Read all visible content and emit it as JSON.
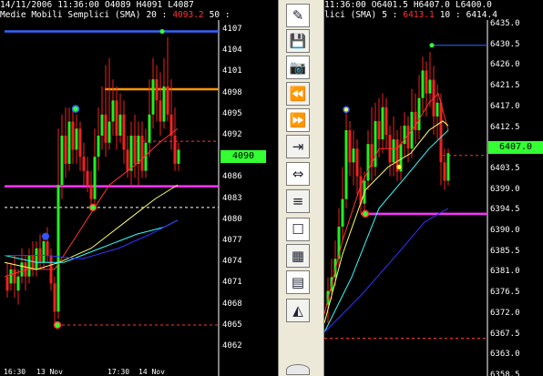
{
  "left_chart": {
    "date": "14/11/2006",
    "time": "11:36:00",
    "open": "O4089",
    "high": "H4091",
    "low": "L4087",
    "indicator": "Medie Mobili Semplici (SMA)",
    "sma1_period": "20 :",
    "sma1_value": "4093.2",
    "sma2_period": "50 :",
    "current_price": "4090",
    "y_ticks": [
      "4107",
      "4104",
      "4101",
      "4098",
      "4095",
      "4092",
      "4089",
      "4086",
      "4083",
      "4080",
      "4077",
      "4074",
      "4071",
      "4068",
      "4065",
      "4062"
    ],
    "x_ticks": [
      "16:30",
      "13 Nov",
      "17:30",
      "14 Nov"
    ],
    "colors": {
      "price_box": "#33ff33",
      "support": "#ff33ff",
      "resistance": "#3366ff",
      "target": "#ff9900"
    }
  },
  "right_chart": {
    "title_fragment": "lici (SMA)",
    "open": "O6401.5",
    "high": "H6407.0",
    "low": "L6400.0",
    "sma1_period": "5 :",
    "sma1_value": "6413.1",
    "sma2_period": "10 :",
    "sma2_value": "6414.4",
    "current_price": "6407.0",
    "y_ticks": [
      "6435.0",
      "6430.5",
      "6426.0",
      "6421.5",
      "6417.0",
      "6412.5",
      "6408.0",
      "6403.5",
      "6399.0",
      "6394.5",
      "6390.0",
      "6385.5",
      "6381.0",
      "6376.5",
      "6372.0",
      "6367.5",
      "6363.0",
      "6358.5"
    ],
    "colors": {
      "price_box": "#33ff33",
      "support": "#ff33ff"
    }
  },
  "toolbar": {
    "buttons": [
      {
        "name": "pencil-tool-button",
        "glyph": "✎"
      },
      {
        "name": "save-button",
        "glyph": "💾"
      },
      {
        "name": "camera-button",
        "glyph": "📷"
      },
      {
        "name": "rewind-button",
        "glyph": "⏪"
      },
      {
        "name": "fast-forward-button",
        "glyph": "⏩"
      },
      {
        "name": "zoom-in-horizontal-button",
        "glyph": "⇥"
      },
      {
        "name": "zoom-out-horizontal-button",
        "glyph": "⇔"
      },
      {
        "name": "indicator-button",
        "glyph": "≡"
      },
      {
        "name": "frame-button",
        "glyph": "☐"
      },
      {
        "name": "layout-button",
        "glyph": "▦"
      },
      {
        "name": "table-button",
        "glyph": "▤"
      },
      {
        "name": "color-scheme-button",
        "glyph": "◭"
      }
    ]
  }
}
